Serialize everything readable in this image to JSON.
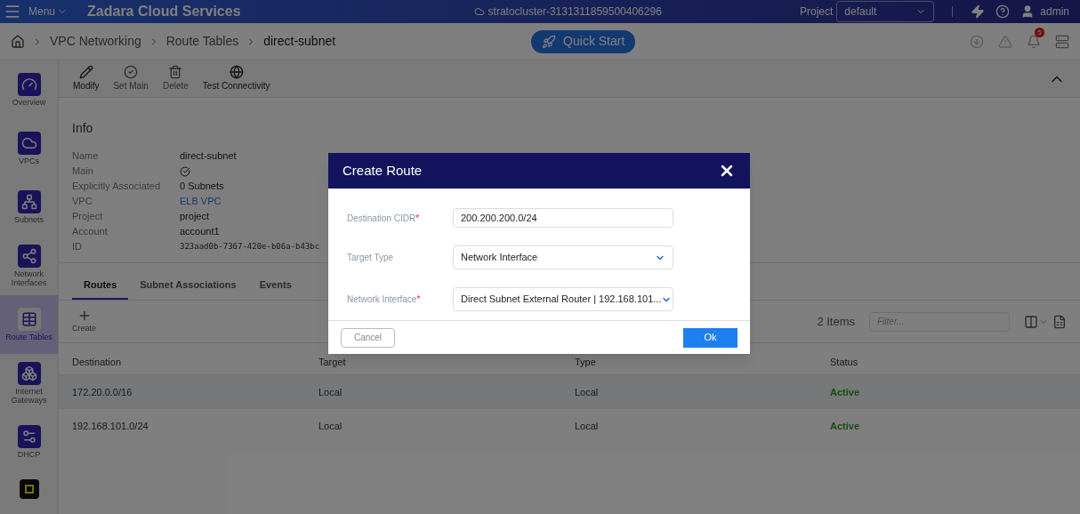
{
  "topbar": {
    "menu": "Menu",
    "brand": "Zadara Cloud Services",
    "cluster": "stratocluster-3131311859500406296",
    "project_label": "Project",
    "project": "default",
    "user": "admin"
  },
  "breadcrumb": {
    "items": [
      "VPC Networking",
      "Route Tables",
      "direct-subnet"
    ],
    "quick_start": "Quick Start",
    "notifications": "5"
  },
  "sidebar": {
    "items": [
      {
        "label": "Overview",
        "selected": false
      },
      {
        "label": "VPCs",
        "selected": false
      },
      {
        "label": "Subnets",
        "selected": false
      },
      {
        "label": "Network Interfaces",
        "selected": false
      },
      {
        "label": "Route Tables",
        "selected": true
      },
      {
        "label": "Internet Gateways",
        "selected": false
      },
      {
        "label": "DHCP",
        "selected": false
      }
    ]
  },
  "toolbar": [
    {
      "label": "Modify",
      "disabled": false
    },
    {
      "label": "Set Main",
      "disabled": true
    },
    {
      "label": "Delete",
      "disabled": true
    },
    {
      "label": "Test Connectivity",
      "disabled": false
    }
  ],
  "info": {
    "title": "Info",
    "rows": [
      {
        "label": "Name",
        "value": "direct-subnet",
        "kind": "text"
      },
      {
        "label": "Main",
        "checked": true,
        "kind": "check"
      },
      {
        "label": "Explicitly Associated",
        "value": "0 Subnets",
        "kind": "text"
      },
      {
        "label": "VPC",
        "value": "ELB VPC",
        "kind": "link"
      },
      {
        "label": "Project",
        "value": "project",
        "kind": "text"
      },
      {
        "label": "Account",
        "value": "account1",
        "kind": "text"
      },
      {
        "label": "ID",
        "value": "323aad0b-7367-420e-b06a-b43bc",
        "kind": "mono"
      }
    ]
  },
  "tabs": [
    {
      "label": "Routes",
      "selected": true
    },
    {
      "label": "Subnet Associations",
      "selected": false
    },
    {
      "label": "Events",
      "selected": false
    }
  ],
  "actions": {
    "create": "Create",
    "count": "2 Items",
    "filter_placeholder": "Filter..."
  },
  "table": {
    "columns": [
      "Destination",
      "Target",
      "Type",
      "Status"
    ],
    "rows": [
      {
        "cells": [
          "172.20.0.0/16",
          "Local",
          "Local",
          "Active"
        ]
      },
      {
        "cells": [
          "192.168.101.0/24",
          "Local",
          "Local",
          "Active"
        ]
      }
    ]
  },
  "dialog": {
    "title": "Create Route",
    "fields": [
      {
        "label": "Destination CIDR",
        "required_mark": "*",
        "value": "200.200.200.0/24",
        "kind": "input"
      },
      {
        "label": "Target Type",
        "value": "Network Interface",
        "kind": "select"
      },
      {
        "label": "Network Interface",
        "required_mark": "*",
        "value": "Direct Subnet External Router | 192.168.101...",
        "kind": "select"
      }
    ],
    "cancel": "Cancel",
    "ok": "Ok"
  }
}
